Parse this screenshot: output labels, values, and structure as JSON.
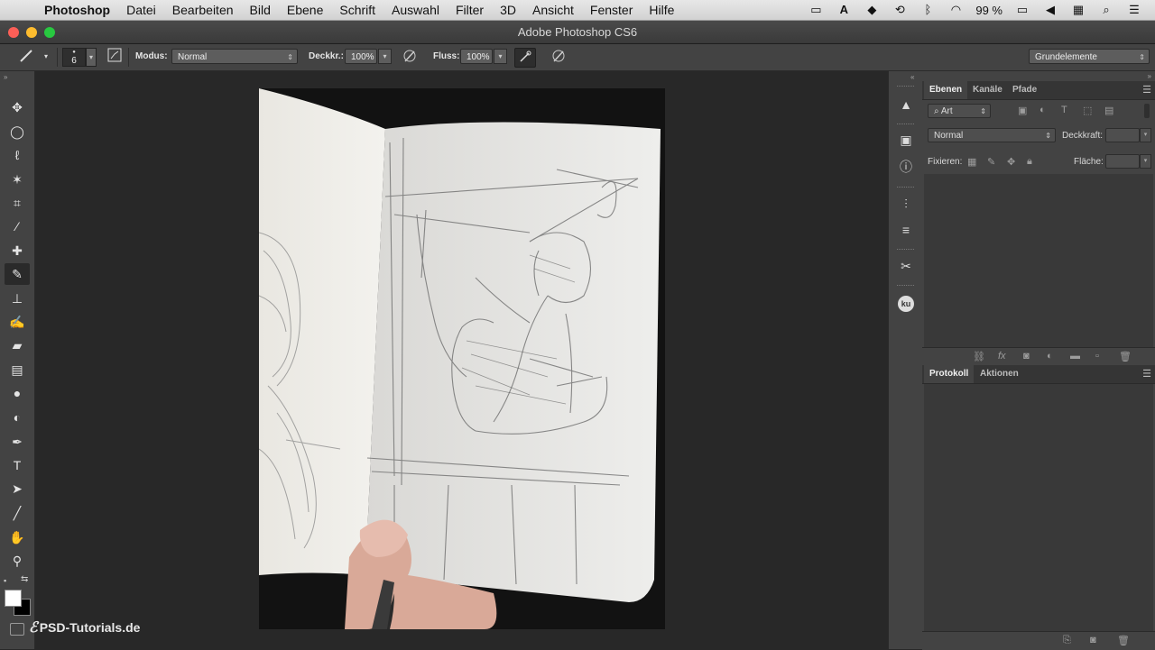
{
  "menubar": {
    "app_name": "Photoshop",
    "items": [
      "Datei",
      "Bearbeiten",
      "Bild",
      "Ebene",
      "Schrift",
      "Auswahl",
      "Filter",
      "3D",
      "Ansicht",
      "Fenster",
      "Hilfe"
    ],
    "battery": "99 %"
  },
  "window": {
    "title": "Adobe Photoshop CS6",
    "close_color": "#fc5f57",
    "minimize_color": "#fdbc2e",
    "zoom_color": "#28c840"
  },
  "options": {
    "brush_size": "6",
    "modus_label": "Modus:",
    "modus_value": "Normal",
    "deckkr_label": "Deckkr.:",
    "deckkr_value": "100%",
    "fluss_label": "Fluss:",
    "fluss_value": "100%",
    "workspace": "Grundelemente"
  },
  "layers_panel": {
    "tabs": [
      "Ebenen",
      "Kanäle",
      "Pfade"
    ],
    "filter_value": "Art",
    "blend_value": "Normal",
    "deckkraft_label": "Deckkraft:",
    "fixieren_label": "Fixieren:",
    "flaeche_label": "Fläche:"
  },
  "history_panel": {
    "tabs": [
      "Protokoll",
      "Aktionen"
    ]
  },
  "watermark": "PSD-Tutorials.de",
  "accent_color": "#282828"
}
